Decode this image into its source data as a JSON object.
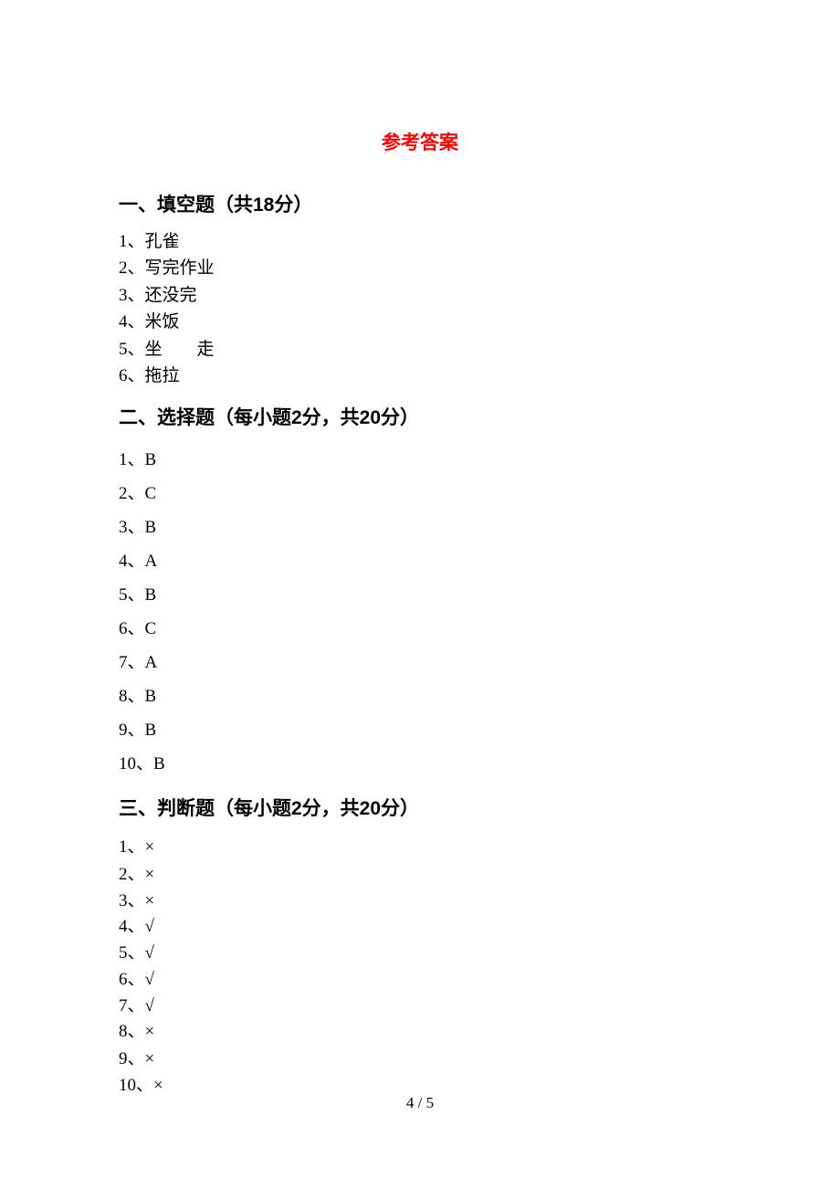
{
  "title": "参考答案",
  "section1": {
    "heading": "一、填空题（共18分）",
    "items": [
      "1、孔雀",
      "2、写完作业",
      "3、还没完",
      "4、米饭",
      "5、坐  走",
      "6、拖拉"
    ]
  },
  "section2": {
    "heading": "二、选择题（每小题2分，共20分）",
    "items": [
      "1、B",
      "2、C",
      "3、B",
      "4、A",
      "5、B",
      "6、C",
      "7、A",
      "8、B",
      "9、B",
      "10、B"
    ]
  },
  "section3": {
    "heading": "三、判断题（每小题2分，共20分）",
    "items": [
      "1、×",
      "2、×",
      "3、×",
      "4、√",
      "5、√",
      "6、√",
      "7、√",
      "8、×",
      "9、×",
      "10、×"
    ],
    "tightIndexes": [
      3,
      6
    ]
  },
  "pageNumber": "4 / 5"
}
